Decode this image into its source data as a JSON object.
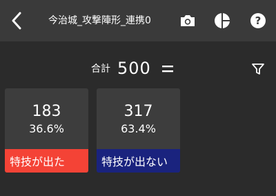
{
  "header": {
    "title": "今治城_攻撃陣形_連携0",
    "icons": [
      "back-chevron-icon",
      "camera-icon",
      "pie-chart-icon",
      "help-icon"
    ]
  },
  "summary": {
    "total_label": "合計",
    "total_value": "500",
    "filter_icon": "filter-icon"
  },
  "cards": [
    {
      "count": "183",
      "percent": "36.6%",
      "label": "特技が出た",
      "color": "#f44336"
    },
    {
      "count": "317",
      "percent": "63.4%",
      "label": "特技が出ない",
      "color": "#1a237e"
    }
  ],
  "colors": {
    "header_bg": "#3a3a3a",
    "page_bg": "#2b2b2b",
    "card_bg": "#3d3d3d"
  }
}
